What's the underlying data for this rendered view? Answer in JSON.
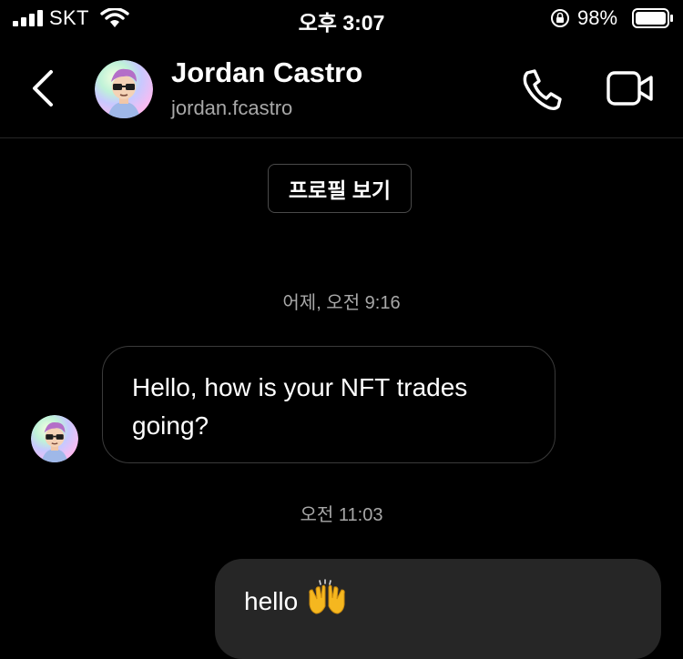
{
  "status_bar": {
    "carrier": "SKT",
    "time": "오후 3:07",
    "battery_percent": "98%",
    "battery_level": 0.98,
    "icons": [
      "signal-bars-icon",
      "wifi-icon",
      "orientation-lock-icon",
      "battery-icon"
    ]
  },
  "header": {
    "name": "Jordan Castro",
    "username": "jordan.fcastro",
    "icons": [
      "back-chevron-icon",
      "phone-icon",
      "video-camera-icon"
    ]
  },
  "profile_button": {
    "label": "프로필 보기"
  },
  "conversation": {
    "timestamp_1": "어제, 오전 9:16",
    "incoming_message": "Hello, how is your NFT trades going?",
    "timestamp_2": "오전 11:03",
    "outgoing_message": "hello",
    "outgoing_emoji_icon": "raising-hands-emoji-icon"
  },
  "colors": {
    "background": "#000000",
    "secondary_text": "#a8a8a8",
    "incoming_bubble_border": "#3a3a3a",
    "outgoing_bubble": "#262626",
    "emoji_yellow": "#f5b71f"
  }
}
